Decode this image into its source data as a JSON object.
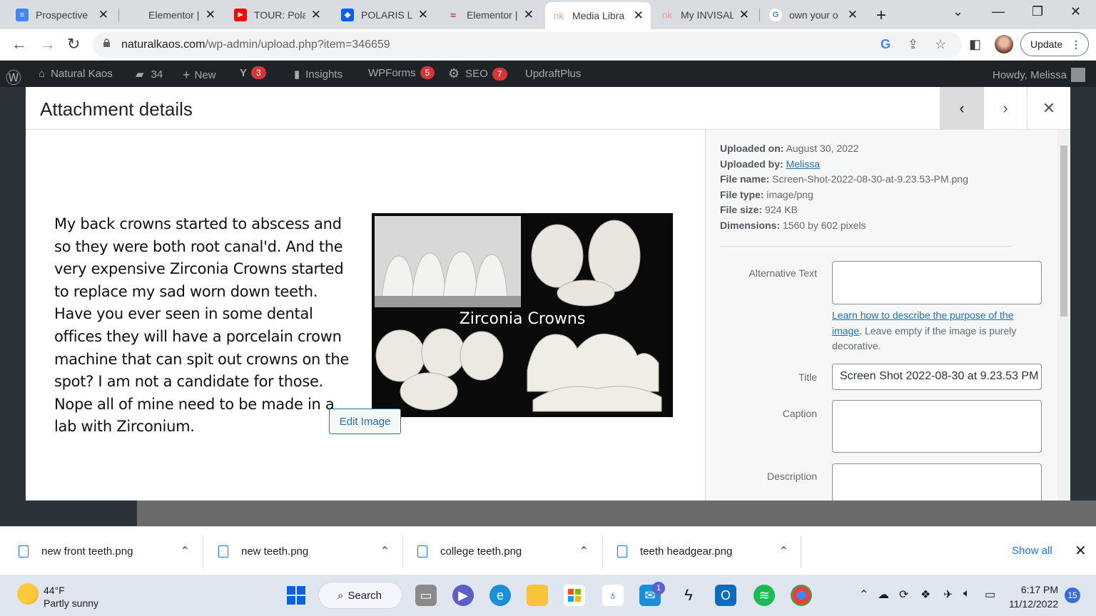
{
  "browser": {
    "tabs": [
      {
        "title": "Prospective",
        "icon": "docs-icon",
        "color": "#4285f4"
      },
      {
        "title": "Elementor |",
        "icon": "blank-icon",
        "color": "#d9dce1"
      },
      {
        "title": "TOUR: Pola",
        "icon": "youtube-icon",
        "color": "#ff0000"
      },
      {
        "title": "POLARIS LC",
        "icon": "dropbox-icon",
        "color": "#0061fe"
      },
      {
        "title": "Elementor |",
        "icon": "elementor-icon",
        "color": "#d63638"
      },
      {
        "title": "Media Libra",
        "icon": "nk-icon",
        "color": "#e8a890"
      },
      {
        "title": "My INVISAL",
        "icon": "nk-icon",
        "color": "#e8a890"
      },
      {
        "title": "own your o",
        "icon": "google-icon",
        "color": "#4285f4"
      }
    ],
    "url_host": "naturalkaos.com",
    "url_path": "/wp-admin/upload.php?item=346659",
    "update_label": "Update"
  },
  "adminbar": {
    "site_name": "Natural Kaos",
    "comments_count": "34",
    "new_label": "New",
    "yoast_count": "3",
    "insights_label": "Insights",
    "wpforms_label": "WPForms",
    "wpforms_count": "5",
    "seo_label": "SEO",
    "seo_count": "7",
    "updraft_label": "UpdraftPlus",
    "howdy": "Howdy, Melissa"
  },
  "modal": {
    "title": "Attachment details",
    "preview_text": "My back crowns started to abscess and so they were both root canal'd. And the very expensive Zirconia Crowns started to replace my sad worn down teeth. Have you ever seen in some dental offices they will have a porcelain crown machine that can spit out crowns on the spot?  I am not a candidate for those. Nope all of mine need to be made in a lab with Zirconium.",
    "image_label": "Zirconia Crowns",
    "edit_image_label": "Edit Image",
    "details": {
      "uploaded_on_label": "Uploaded on:",
      "uploaded_on": "August 30, 2022",
      "uploaded_by_label": "Uploaded by:",
      "uploaded_by": "Melissa",
      "file_name_label": "File name:",
      "file_name": "Screen-Shot-2022-08-30-at-9.23.53-PM.png",
      "file_type_label": "File type:",
      "file_type": "image/png",
      "file_size_label": "File size:",
      "file_size": "924 KB",
      "dimensions_label": "Dimensions:",
      "dimensions": "1560 by 602 pixels"
    },
    "fields": {
      "alt_label": "Alternative Text",
      "alt_value": "",
      "alt_help_link": "Learn how to describe the purpose of the image",
      "alt_help_rest": ". Leave empty if the image is purely decorative.",
      "title_label": "Title",
      "title_value": "Screen Shot 2022-08-30 at 9.23.53 PM",
      "caption_label": "Caption",
      "caption_value": "",
      "description_label": "Description",
      "description_value": ""
    }
  },
  "downloads": {
    "items": [
      "new front teeth.png",
      "new teeth.png",
      "college teeth.png",
      "teeth headgear.png"
    ],
    "show_all": "Show all"
  },
  "taskbar": {
    "temperature": "44°F",
    "weather": "Partly sunny",
    "search_label": "Search",
    "mail_badge": "1",
    "time": "6:17 PM",
    "date": "11/12/2022",
    "notifications": "15"
  }
}
